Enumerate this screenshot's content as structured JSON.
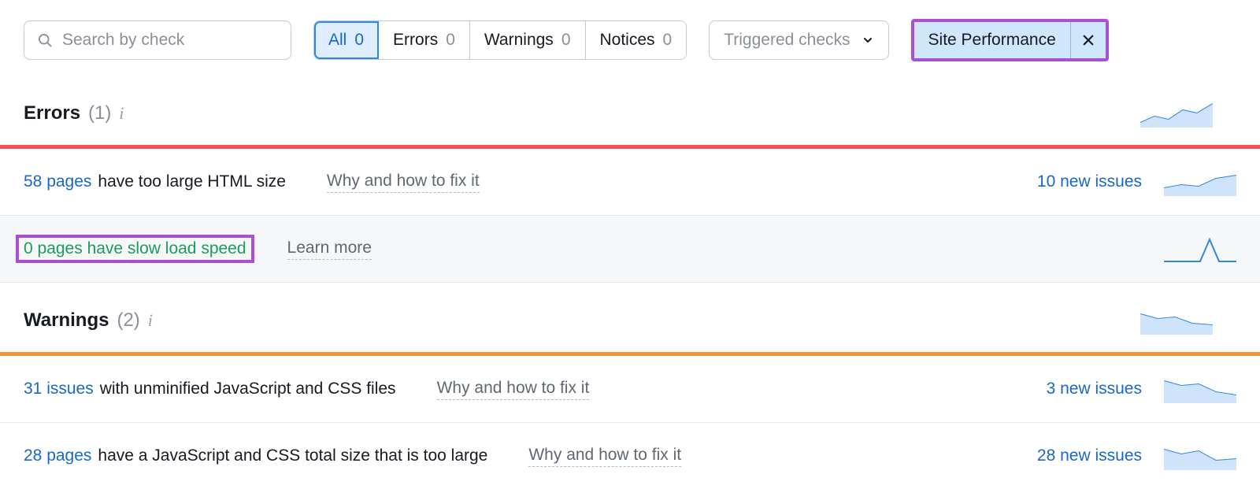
{
  "search": {
    "placeholder": "Search by check"
  },
  "filters": {
    "all": {
      "label": "All",
      "count": "0"
    },
    "errors": {
      "label": "Errors",
      "count": "0"
    },
    "warnings": {
      "label": "Warnings",
      "count": "0"
    },
    "notices": {
      "label": "Notices",
      "count": "0"
    }
  },
  "dropdown": {
    "label": "Triggered checks"
  },
  "chip": {
    "label": "Site Performance"
  },
  "sections": {
    "errors": {
      "title": "Errors",
      "count": "(1)"
    },
    "warnings": {
      "title": "Warnings",
      "count": "(2)"
    }
  },
  "rows": {
    "r1_link": "58 pages",
    "r1_rest": "have too large HTML size",
    "r1_hint": "Why and how to fix it",
    "r1_new": "10 new issues",
    "r2_text": "0 pages have slow load speed",
    "r2_hint": "Learn more",
    "r3_link": "31 issues",
    "r3_rest": "with unminified JavaScript and CSS files",
    "r3_hint": "Why and how to fix it",
    "r3_new": "3 new issues",
    "r4_link": "28 pages",
    "r4_rest": "have a JavaScript and CSS total size that is too large",
    "r4_hint": "Why and how to fix it",
    "r4_new": "28 new issues"
  }
}
